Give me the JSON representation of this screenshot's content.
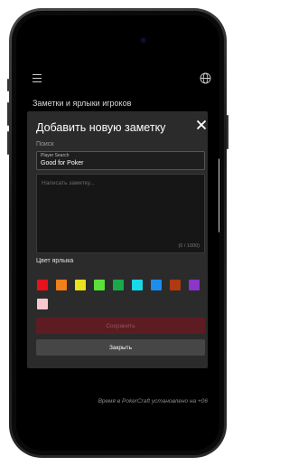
{
  "header": {
    "title": "Заметки и ярлыки игроков",
    "menu_icon": "hamburger-menu-icon",
    "globe_icon": "globe-icon"
  },
  "modal": {
    "title": "Добавить новую заметку",
    "close_icon": "close-icon",
    "search_label": "Поиск",
    "player_field": {
      "label": "Player Search",
      "value": "Good for Poker"
    },
    "note": {
      "placeholder": "Написать заметку...",
      "counter": "(0 / 1000)"
    },
    "color_label": "Цвет ярлыка",
    "colors": [
      "#e8121b",
      "#f07f1c",
      "#e9e21e",
      "#5be03b",
      "#19a94a",
      "#19d8e8",
      "#1d8df0",
      "#b03a10",
      "#8a36c9",
      "#f6c7cf"
    ],
    "save_label": "Сохранить",
    "close_label": "Закрыть"
  },
  "footer_note": "Время в PokerCraft установлено на +06"
}
